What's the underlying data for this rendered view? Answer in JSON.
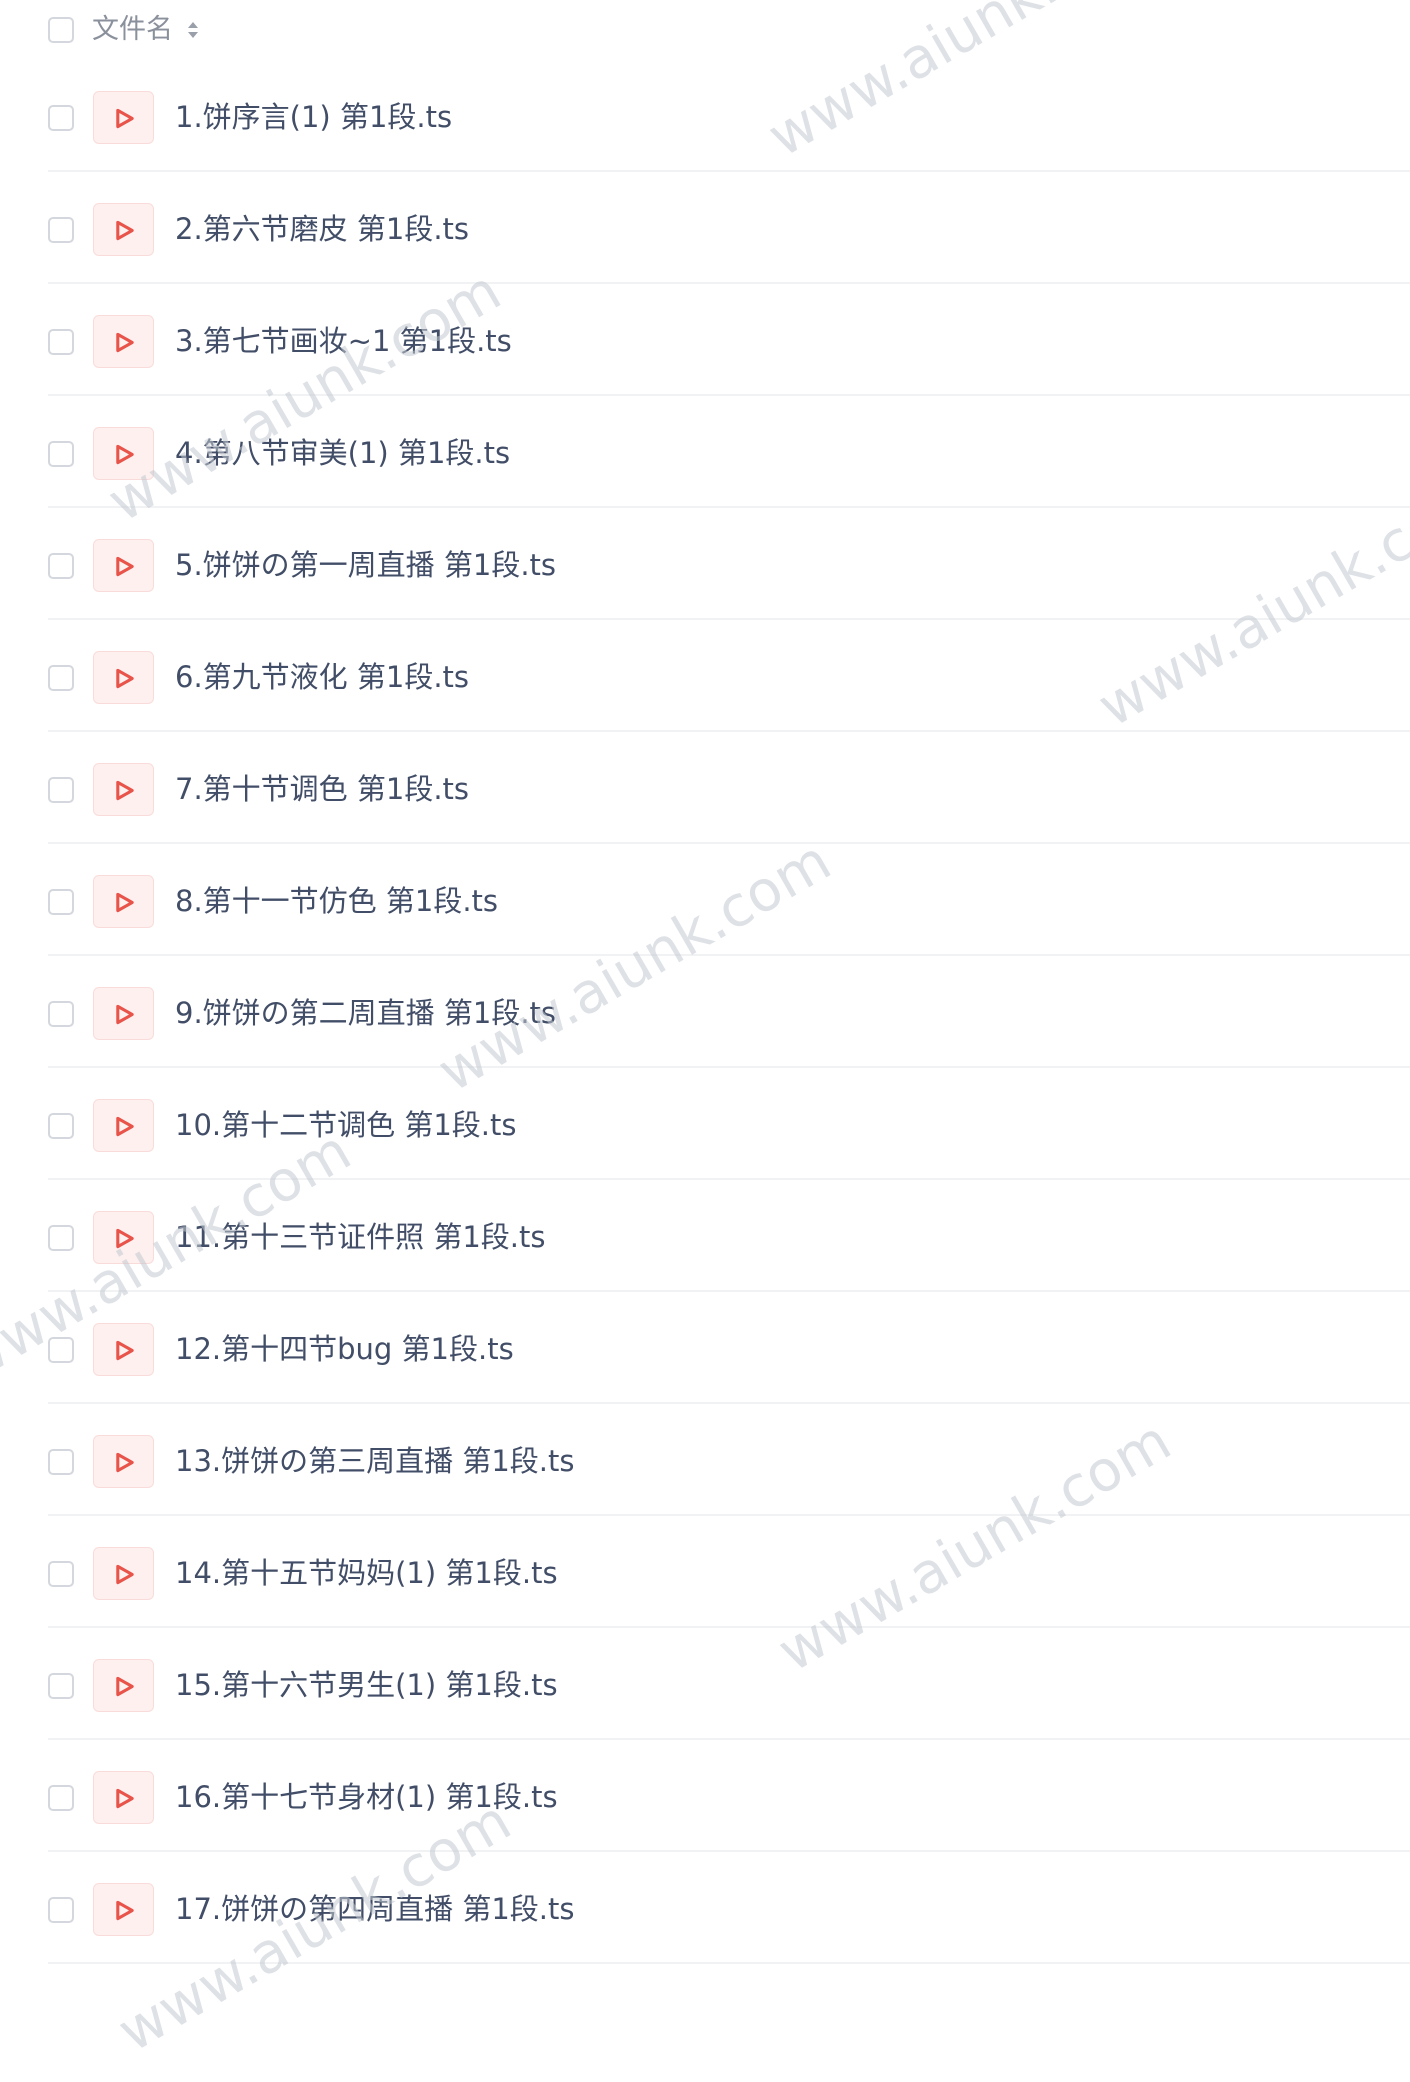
{
  "header": {
    "column_label": "文件名"
  },
  "files": [
    {
      "name": "1.饼序言(1) 第1段.ts"
    },
    {
      "name": "2.第六节磨皮 第1段.ts"
    },
    {
      "name": "3.第七节画妆~1 第1段.ts"
    },
    {
      "name": "4.第八节审美(1) 第1段.ts"
    },
    {
      "name": "5.饼饼の第一周直播 第1段.ts"
    },
    {
      "name": "6.第九节液化 第1段.ts"
    },
    {
      "name": "7.第十节调色 第1段.ts"
    },
    {
      "name": "8.第十一节仿色 第1段.ts"
    },
    {
      "name": "9.饼饼の第二周直播 第1段.ts"
    },
    {
      "name": "10.第十二节调色 第1段.ts"
    },
    {
      "name": "11.第十三节证件照 第1段.ts"
    },
    {
      "name": "12.第十四节bug 第1段.ts"
    },
    {
      "name": "13.饼饼の第三周直播 第1段.ts"
    },
    {
      "name": "14.第十五节妈妈(1) 第1段.ts"
    },
    {
      "name": "15.第十六节男生(1) 第1段.ts"
    },
    {
      "name": "16.第十七节身材(1) 第1段.ts"
    },
    {
      "name": "17.饼饼の第四周直播 第1段.ts"
    }
  ],
  "watermark_text": "www.aiunk.com",
  "icons": {
    "file_type": "video-play-icon",
    "sort": "sort-arrows-icon"
  },
  "colors": {
    "icon_accent": "#e8534a",
    "icon_background": "#fdf0ef",
    "text": "#424e67",
    "header_text": "#8a909c",
    "divider": "#f1f2f4",
    "checkbox_border": "#d4d7dd"
  }
}
